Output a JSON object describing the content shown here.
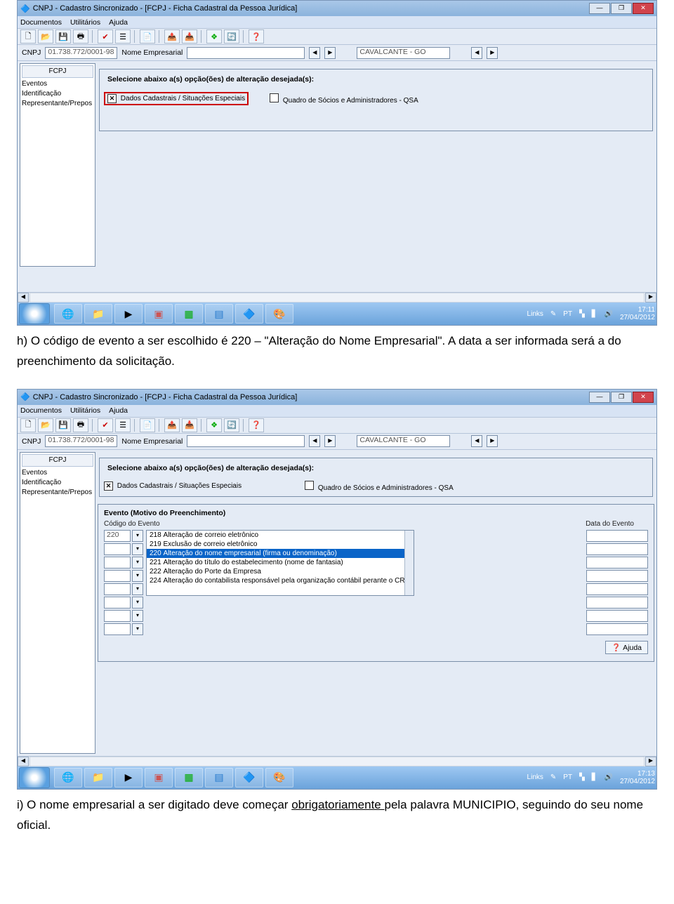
{
  "win": {
    "title": "CNPJ - Cadastro Sincronizado - [FCPJ - Ficha Cadastral da Pessoa Jurídica]",
    "menu": [
      "Documentos",
      "Utilitários",
      "Ajuda"
    ],
    "cnpj_label": "CNPJ",
    "cnpj_value": "01.738.772/0001-98",
    "nome_label": "Nome Empresarial",
    "nome_value": "",
    "municipio_value": "CAVALCANTE - GO"
  },
  "sidebar": {
    "header": "FCPJ",
    "items": [
      "Eventos",
      "Identificação",
      "Representante/Prepos"
    ]
  },
  "group1": {
    "legend": "Selecione abaixo a(s) opção(ões) de alteração desejada(s):",
    "opt1": "Dados Cadastrais / Situações Especiais",
    "opt2": "Quadro de Sócios e Administradores - QSA"
  },
  "evento": {
    "legend": "Evento (Motivo do Preenchimento)",
    "col_codigo": "Código do Evento",
    "col_data": "Data do Evento",
    "code_value": "220",
    "list": [
      {
        "c": "218",
        "t": "Alteração de correio eletrônico"
      },
      {
        "c": "219",
        "t": "Exclusão de correio eletrônico"
      },
      {
        "c": "220",
        "t": "Alteração do nome empresarial (firma ou denominação)"
      },
      {
        "c": "221",
        "t": "Alteração do título do estabelecimento (nome de fantasia)"
      },
      {
        "c": "222",
        "t": "Alteração do Porte da Empresa"
      },
      {
        "c": "224",
        "t": "Alteração do contabilista responsável pela organização contábil perante o CRC"
      }
    ],
    "ajuda": "Ajuda"
  },
  "taskbar": {
    "links_label": "Links",
    "lang": "PT",
    "time1": "17:11",
    "date1": "27/04/2012",
    "time2": "17:13",
    "date2": "27/04/2012"
  },
  "doc": {
    "p_h": "h)  O código de evento a ser escolhido é 220 – \"Alteração do Nome Empresarial\". A data a ser informada será a do preenchimento da solicitação.",
    "p_i_pre": "i) O nome empresarial a ser digitado deve começar ",
    "p_i_u": "obrigatoriamente ",
    "p_i_post": "pela palavra MUNICIPIO, seguindo do seu nome oficial."
  }
}
